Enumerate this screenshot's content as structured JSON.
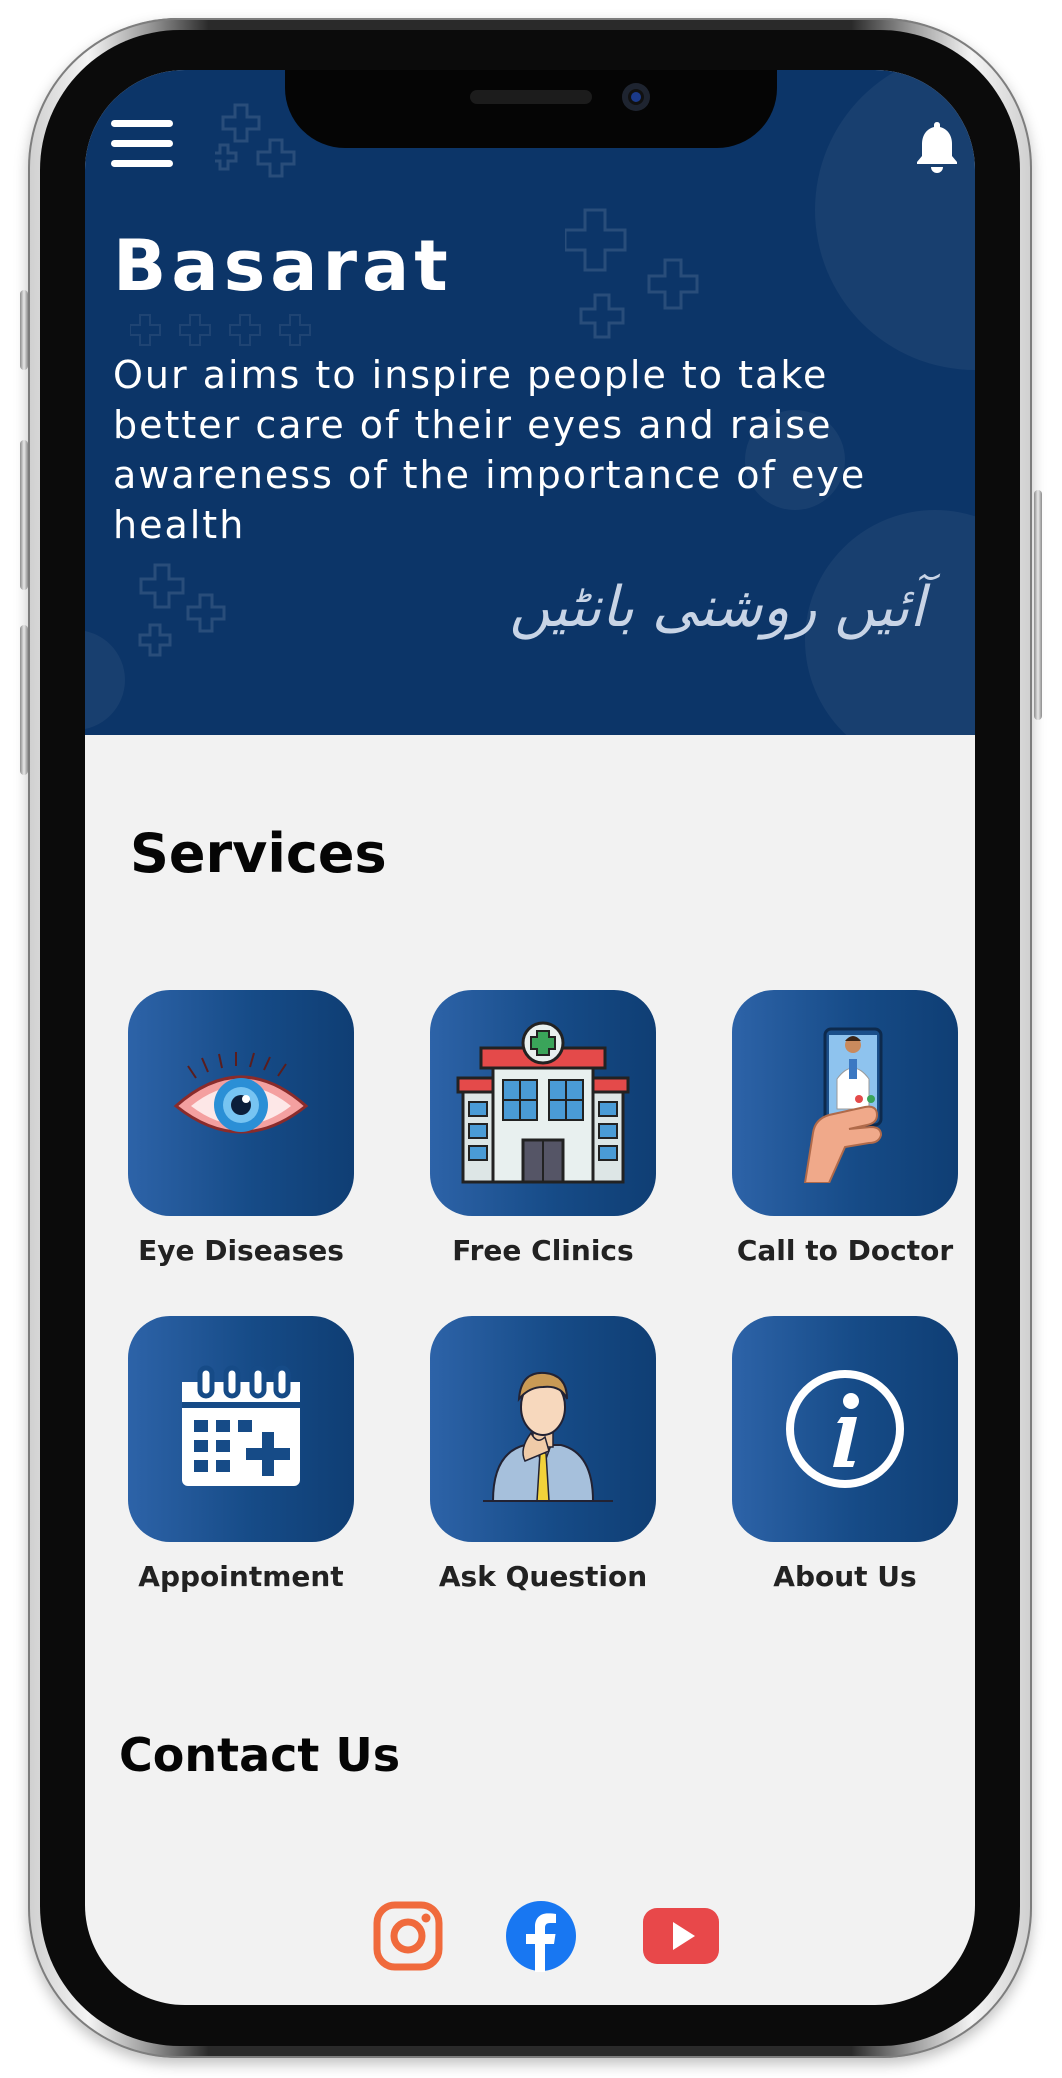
{
  "app": {
    "brand": "Basarat",
    "tagline": "Our aims to inspire people to take better care of their eyes and raise awareness of the importance of eye health",
    "urdu_slogan": "آئیں روشنی بانٹیں",
    "header_color": "#0c3568"
  },
  "icons": {
    "menu": "menu-icon",
    "notifications": "bell-icon"
  },
  "services": {
    "title": "Services",
    "items": [
      {
        "label": "Eye Diseases",
        "icon": "eye-icon"
      },
      {
        "label": "Free Clinics",
        "icon": "hospital-icon"
      },
      {
        "label": "Call to Doctor",
        "icon": "phone-doctor-icon"
      },
      {
        "label": "Appointment",
        "icon": "calendar-add-icon"
      },
      {
        "label": "Ask Question",
        "icon": "thinking-person-icon"
      },
      {
        "label": "About Us",
        "icon": "info-icon"
      }
    ]
  },
  "contact": {
    "title": "Contact Us",
    "socials": [
      {
        "name": "instagram-icon",
        "color": "#f06a3c"
      },
      {
        "name": "facebook-icon",
        "color": "#1877f2"
      },
      {
        "name": "youtube-icon",
        "color": "#e8484a"
      }
    ]
  }
}
